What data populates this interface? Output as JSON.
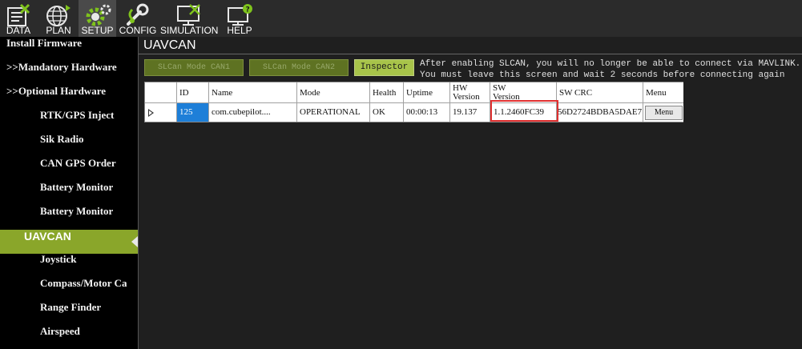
{
  "toolbar": {
    "items": [
      {
        "label": "DATA",
        "icon": "data-icon"
      },
      {
        "label": "PLAN",
        "icon": "plan-globe-icon"
      },
      {
        "label": "SETUP",
        "icon": "setup-gear-icon"
      },
      {
        "label": "CONFIG",
        "icon": "config-wrench-icon"
      },
      {
        "label": "SIMULATION",
        "icon": "simulation-monitor-icon"
      },
      {
        "label": "HELP",
        "icon": "help-monitor-icon"
      }
    ],
    "active": "SETUP"
  },
  "sidebar": {
    "items": [
      {
        "label": "Install Firmware"
      },
      {
        "label": ">>Mandatory Hardware"
      },
      {
        "label": ">>Optional Hardware"
      },
      {
        "label": "RTK/GPS Inject"
      },
      {
        "label": "Sik Radio"
      },
      {
        "label": "CAN GPS Order"
      },
      {
        "label": "Battery Monitor"
      },
      {
        "label": "Battery Monitor"
      },
      {
        "label": "UAVCAN"
      },
      {
        "label": "Joystick"
      },
      {
        "label": "Compass/Motor Ca"
      },
      {
        "label": "Range Finder"
      },
      {
        "label": "Airspeed"
      }
    ]
  },
  "main": {
    "title": "UAVCAN",
    "buttons": {
      "can1": "SLCan Mode CAN1",
      "can2": "SLCan Mode CAN2",
      "inspector": "Inspector"
    },
    "notice": {
      "line1": "After enabling SLCAN, you will no longer be able to connect via MAVLINK.",
      "line2": "You must leave this screen and wait 2 seconds before connecting again"
    },
    "table": {
      "headers": {
        "id": "ID",
        "name": "Name",
        "mode": "Mode",
        "health": "Health",
        "uptime": "Uptime",
        "hw1": "HW",
        "hw2": "Version",
        "sw1": "SW",
        "sw2": "Version",
        "crc": "SW CRC",
        "menu": "Menu"
      },
      "row": {
        "id": "125",
        "name": "com.cubepilot....",
        "mode": "OPERATIONAL",
        "health": "OK",
        "uptime": "00:00:13",
        "hw": "19.137",
        "sw": "1.1.2460FC39",
        "crc": "56D2724BDBA5DAE7",
        "menu": "Menu"
      }
    }
  },
  "colors": {
    "accent": "#8aa62a",
    "selection": "#1e7fd8",
    "highlight": "#e03030"
  }
}
